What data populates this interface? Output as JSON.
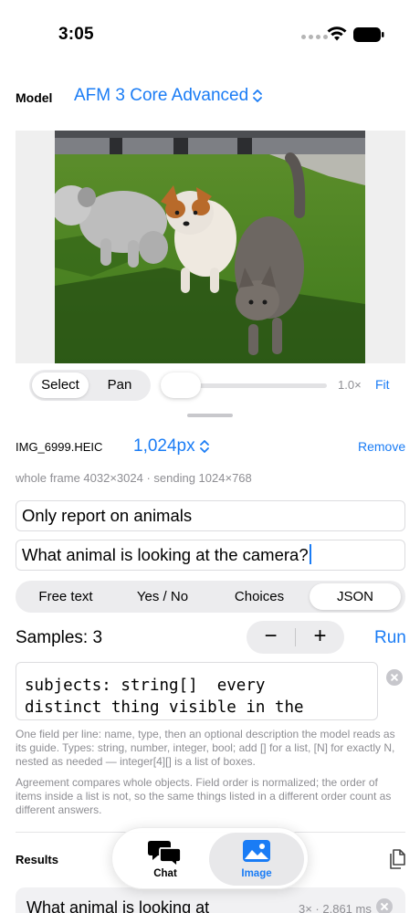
{
  "status": {
    "time": "3:05"
  },
  "model": {
    "label": "Model",
    "value": "AFM 3 Core Advanced"
  },
  "viewer": {
    "modes": [
      "Select",
      "Pan"
    ],
    "selected_mode": "Select",
    "zoom": "1.0×",
    "fit_label": "Fit",
    "zoom_level": 0.0
  },
  "image": {
    "file_name": "IMG_6999.HEIC",
    "resolution": "1,024px",
    "remove_label": "Remove",
    "frame_info": "whole frame 4032×3024 · sending 1024×768"
  },
  "inputs": {
    "system": "Only report on animals",
    "prompt": "What animal is looking at the camera?"
  },
  "format": {
    "options": [
      "Free text",
      "Yes / No",
      "Choices",
      "JSON"
    ],
    "selected": "JSON"
  },
  "samples": {
    "label": "Samples: 3",
    "minus": "−",
    "plus": "+",
    "run_label": "Run"
  },
  "schema": {
    "text": "subjects: string[]  every\ndistinct thing visible in the"
  },
  "help": {
    "fields": "One field per line: name, type, then an optional description the model reads as its guide. Types: string, number, integer, bool; add [] for a list, [N] for exactly N, nested as needed — integer[4][] is a list of boxes.",
    "agreement": "Agreement compares whole objects. Field order is normalized; the order of items inside a list is not, so the same things listed in a different order count as different answers."
  },
  "results": {
    "label": "Results",
    "items": [
      {
        "text": "What animal is looking at",
        "meta": "3× · 2,861 ms"
      }
    ]
  },
  "tabs": [
    {
      "label": "Chat",
      "icon": "chat-bubbles-icon",
      "active": false
    },
    {
      "label": "Image",
      "icon": "photo-icon",
      "active": true
    }
  ],
  "colors": {
    "accent": "#1a7cf5",
    "secondary_text": "#8e8e93",
    "control_fill": "#ececee"
  }
}
